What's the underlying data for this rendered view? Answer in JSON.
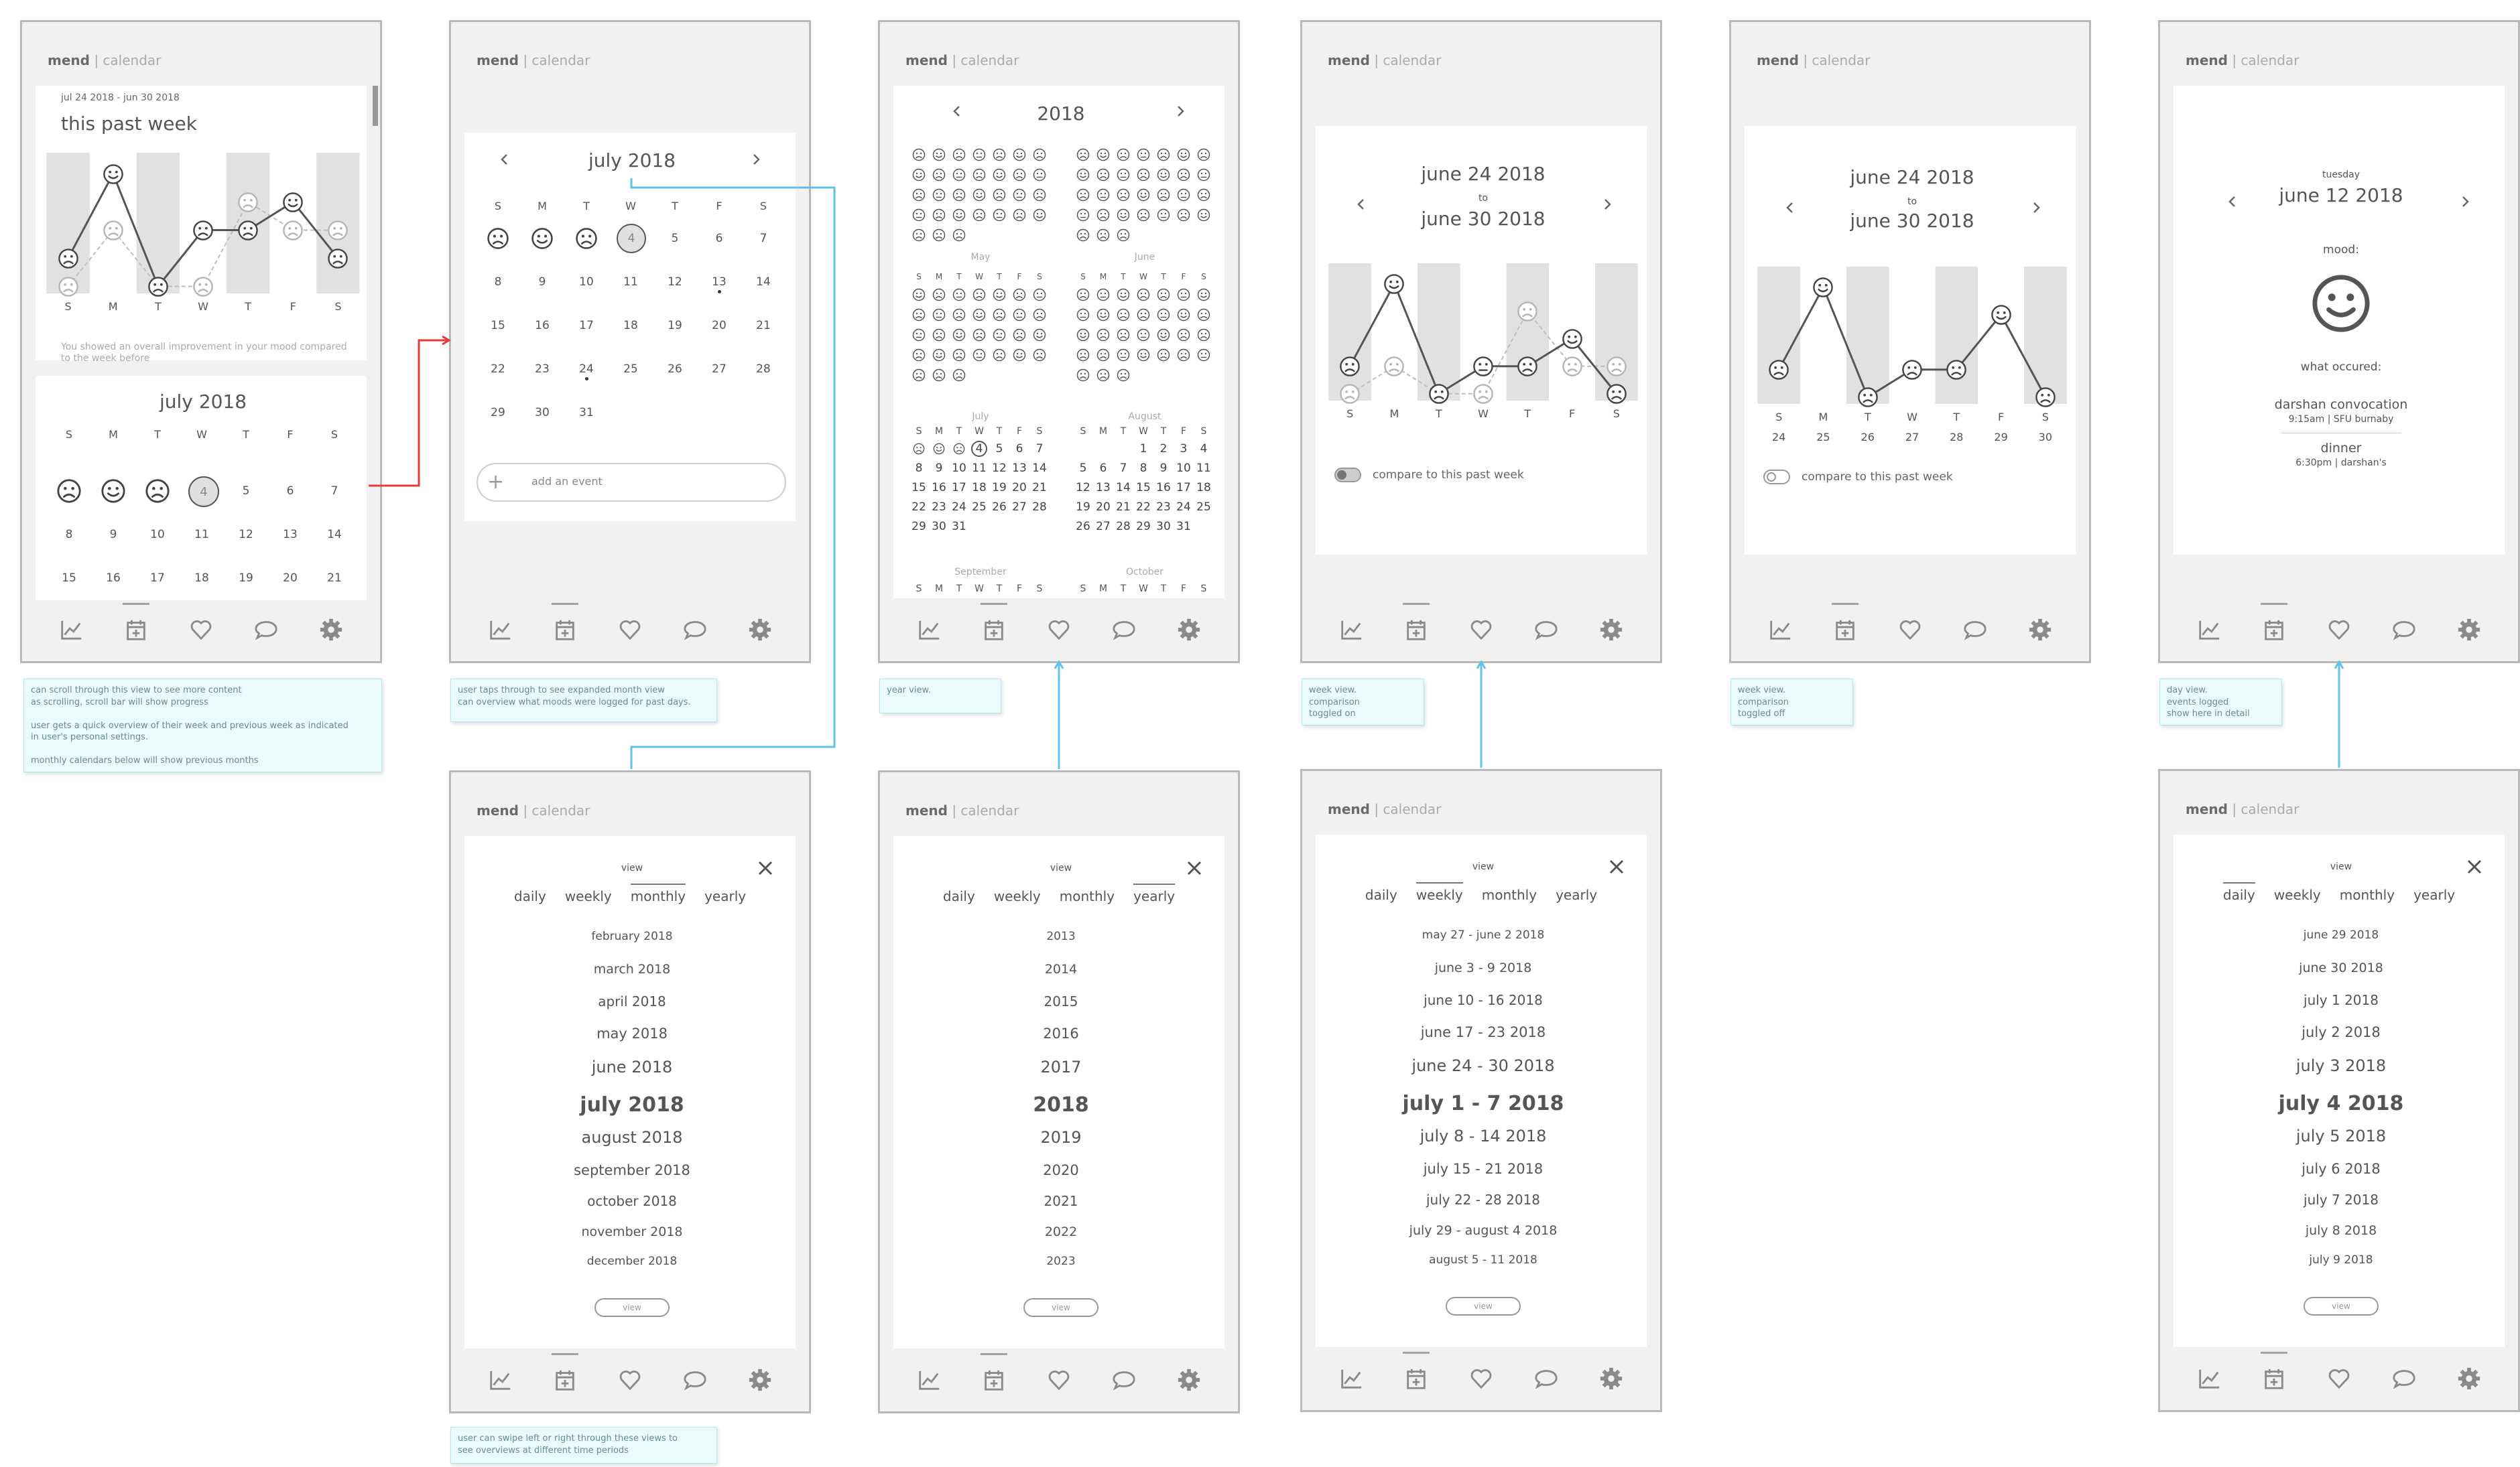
{
  "brand": {
    "name": "mend",
    "sep": " | ",
    "section": "calendar"
  },
  "nav": [
    "graph-icon",
    "calendar-add-icon",
    "heart-icon",
    "chat-icon",
    "gear-icon"
  ],
  "weekdays": [
    "S",
    "M",
    "T",
    "W",
    "T",
    "F",
    "S"
  ],
  "s1": {
    "range": "jul 24 2018 - jun 30 2018",
    "heading": "this past week",
    "summary": "You showed an overall improvement in your mood compared to the week before",
    "month": "july 2018",
    "today": "4",
    "week1": [
      "",
      "",
      "",
      "",
      "5",
      "6",
      "7"
    ],
    "week2": [
      "8",
      "9",
      "10",
      "11",
      "12",
      "13",
      "14"
    ],
    "week3": [
      "15",
      "16",
      "17",
      "18",
      "19",
      "20",
      "21"
    ]
  },
  "s2": {
    "month": "july 2018",
    "rows": [
      [
        "",
        "",
        "",
        "",
        "5",
        "6",
        "7"
      ],
      [
        "8",
        "9",
        "10",
        "11",
        "12",
        "13",
        "14"
      ],
      [
        "15",
        "16",
        "17",
        "18",
        "19",
        "20",
        "21"
      ],
      [
        "22",
        "23",
        "24",
        "25",
        "26",
        "27",
        "28"
      ],
      [
        "29",
        "30",
        "31",
        "",
        "",
        "",
        ""
      ]
    ],
    "today": "4",
    "add": "add an event"
  },
  "s3": {
    "year": "2018",
    "months": [
      "May",
      "June",
      "July",
      "August",
      "September",
      "October"
    ],
    "july": [
      [
        "1",
        "2",
        "3",
        "4",
        "5",
        "6",
        "7"
      ],
      [
        "8",
        "9",
        "10",
        "11",
        "12",
        "13",
        "14"
      ],
      [
        "15",
        "16",
        "17",
        "18",
        "19",
        "20",
        "21"
      ],
      [
        "22",
        "23",
        "24",
        "25",
        "26",
        "27",
        "28"
      ],
      [
        "29",
        "30",
        "31",
        "",
        "",
        "",
        ""
      ]
    ],
    "august": [
      [
        "",
        "",
        "1",
        "2",
        "3",
        "4"
      ],
      [
        "5",
        "6",
        "7",
        "8",
        "9",
        "10",
        "11"
      ],
      [
        "12",
        "13",
        "14",
        "15",
        "16",
        "17",
        "18"
      ],
      [
        "19",
        "20",
        "21",
        "22",
        "23",
        "24",
        "25"
      ],
      [
        "26",
        "27",
        "28",
        "29",
        "30",
        "31",
        ""
      ]
    ]
  },
  "s4": {
    "line1": "june 24 2018",
    "to": "to",
    "line2": "june 30 2018",
    "toggle": "compare to this past week"
  },
  "s5": {
    "line1": "june 24 2018",
    "to": "to",
    "line2": "june 30 2018",
    "days": [
      "24",
      "25",
      "26",
      "27",
      "28",
      "29",
      "30"
    ],
    "toggle": "compare to this past week"
  },
  "s6": {
    "dow": "tuesday",
    "date": "june 12 2018",
    "mood": "mood:",
    "occured": "what occured:",
    "e1": "darshan convocation",
    "e1d": "9:15am | SFU burnaby",
    "e2": "dinner",
    "e2d": "6:30pm | darshan's"
  },
  "picker": {
    "view": "view",
    "tabs": [
      "daily",
      "weekly",
      "monthly",
      "yearly"
    ],
    "btn": "view",
    "monthly": [
      "february 2018",
      "march 2018",
      "april 2018",
      "may 2018",
      "june 2018",
      "july 2018",
      "august 2018",
      "september 2018",
      "october 2018",
      "november 2018",
      "december 2018"
    ],
    "yearly": [
      "2013",
      "2014",
      "2015",
      "2016",
      "2017",
      "2018",
      "2019",
      "2020",
      "2021",
      "2022",
      "2023"
    ],
    "weekly": [
      "may 27 - june 2 2018",
      "june 3 - 9 2018",
      "june 10 - 16 2018",
      "june 17 - 23 2018",
      "june 24 - 30 2018",
      "july 1 - 7 2018",
      "july 8 - 14 2018",
      "july 15 - 21 2018",
      "july 22 - 28 2018",
      "july 29 - august 4 2018",
      "august 5 - 11 2018"
    ],
    "daily": [
      "june 29 2018",
      "june 30 2018",
      "july 1 2018",
      "july 2 2018",
      "july 3 2018",
      "july 4 2018",
      "july 5 2018",
      "july 6 2018",
      "july 7 2018",
      "july 8 2018",
      "july 9 2018"
    ]
  },
  "notes": {
    "n1": "can scroll through this view to see more content\nas scrolling, scroll bar will show progress\n\nuser gets a quick overview of their week and previous week as indicated\nin user's personal settings.\n\nmonthly calendars below will show previous months",
    "n2": "user taps through to see expanded month view\ncan overview what moods were logged for past days.",
    "n3": "year view.",
    "n4": "week view.\ncomparison\ntoggled on",
    "n5": "week view.\ncomparison\ntoggled off",
    "n6": "day view.\nevents logged\nshow here in detail",
    "n7": "user can swipe left or right through these views to\nsee overviews at different time periods"
  }
}
